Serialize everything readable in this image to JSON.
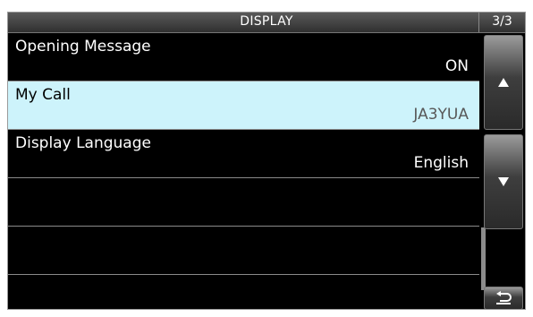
{
  "header": {
    "title": "DISPLAY",
    "page": "3/3"
  },
  "rows": [
    {
      "label": "Opening Message",
      "value": "ON",
      "selected": false
    },
    {
      "label": "My Call",
      "value": "JA3YUA",
      "selected": true
    },
    {
      "label": "Display Language",
      "value": "English",
      "selected": false
    },
    {
      "label": "",
      "value": "",
      "selected": false
    },
    {
      "label": "",
      "value": "",
      "selected": false
    },
    {
      "label": "",
      "value": "",
      "selected": false
    }
  ],
  "buttons": {
    "up_icon": "triangle-up-icon",
    "down_icon": "triangle-down-icon",
    "back_icon": "return-arrow-icon"
  },
  "colors": {
    "selected_row": "#cdf3fb",
    "background": "#000000",
    "text": "#ffffff"
  }
}
